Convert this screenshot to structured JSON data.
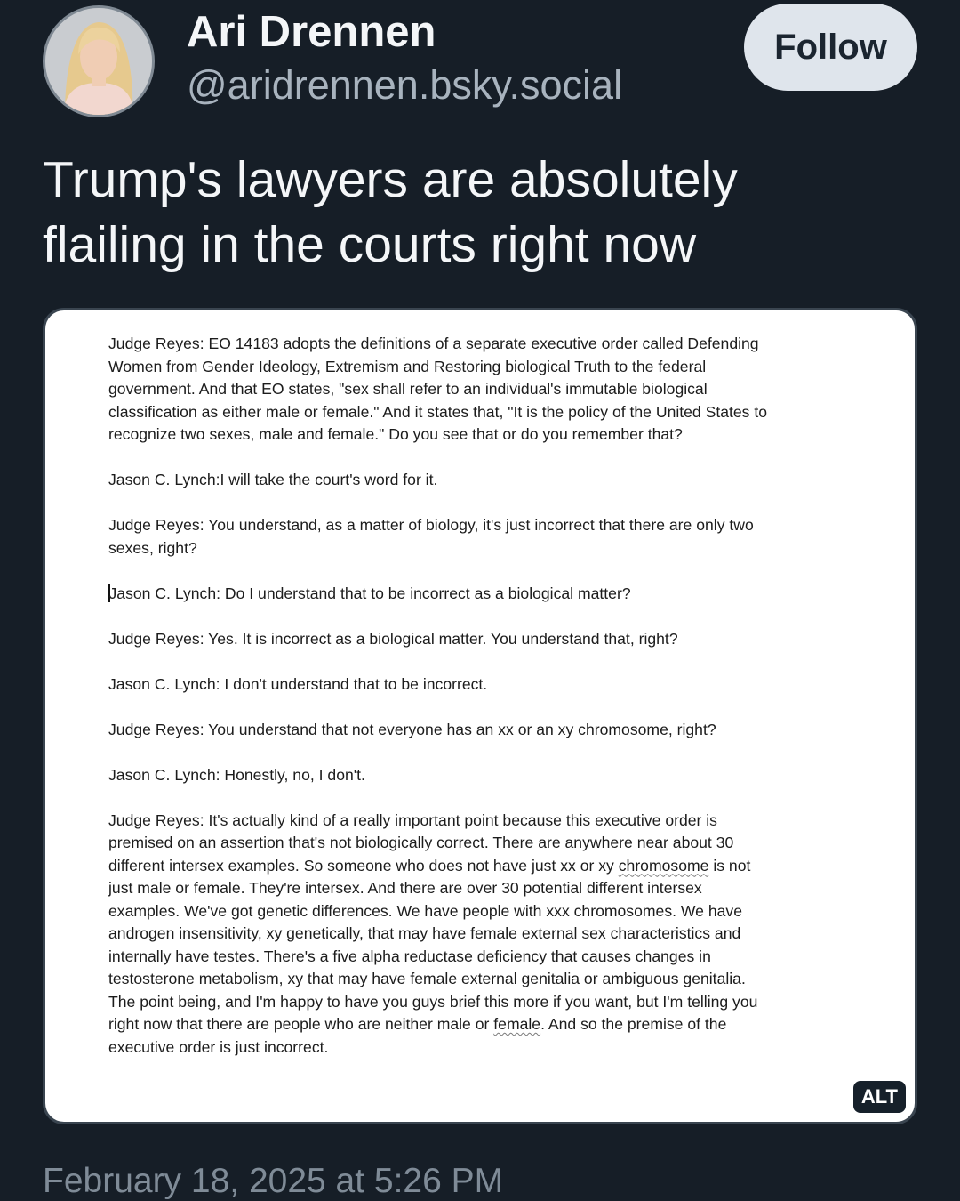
{
  "author": {
    "display_name": "Ari Drennen",
    "handle": "@aridrennen.bsky.social",
    "avatar_icon": "profile-photo"
  },
  "follow_label": "Follow",
  "post_text_lines": [
    "Trump's lawyers are absolutely",
    "flailing in the courts right now"
  ],
  "image": {
    "alt_badge": "ALT",
    "paragraphs": [
      [
        "Judge Reyes: EO 14183 adopts the definitions of a separate executive order called Defending",
        "Women from Gender Ideology, Extremism and Restoring biological Truth to the federal",
        "government. And that EO states, \"sex shall refer to an individual's immutable biological",
        "classification as either male or female.\" And it states that, \"It is the policy of the United States to",
        "recognize two sexes, male and female.\" Do you see that or do you remember that?"
      ],
      [
        "Jason C. Lynch:I will take the court's word for it."
      ],
      [
        "Judge Reyes: You understand, as a matter of biology, it's just incorrect that there are only two",
        "sexes, right?"
      ],
      [
        "Jason C. Lynch: Do I understand that to be incorrect as a biological matter?"
      ],
      [
        "Judge Reyes: Yes. It is incorrect as a biological matter. You understand that, right?"
      ],
      [
        "Jason C. Lynch: I don't understand that to be incorrect."
      ],
      [
        "Judge Reyes: You understand that not everyone has an xx or an xy chromosome, right?"
      ],
      [
        "Jason C. Lynch: Honestly, no, I don't."
      ],
      [
        "Judge Reyes: It's actually kind of a really important point because this executive order is",
        "premised on an assertion that's not biologically correct. There are anywhere near about 30",
        "different intersex examples. So someone who does not have just xx or xy chromosome is not",
        "just male or female. They're intersex. And there are over 30 potential different intersex",
        "examples. We've got genetic differences. We have people with xxx chromosomes. We have",
        "androgen insensitivity, xy genetically, that may have female external sex characteristics and",
        "internally have testes. There's a five alpha reductase deficiency that causes changes in",
        "testosterone metabolism, xy that may have female external genitalia or ambiguous genitalia.",
        "The point being, and I'm happy to have you guys brief this more if you want, but I'm telling you",
        "right now that there are people who are neither male or female. And so the premise of the",
        "executive order is just incorrect."
      ]
    ]
  },
  "timestamp": "February 18, 2025 at 5:26 PM"
}
